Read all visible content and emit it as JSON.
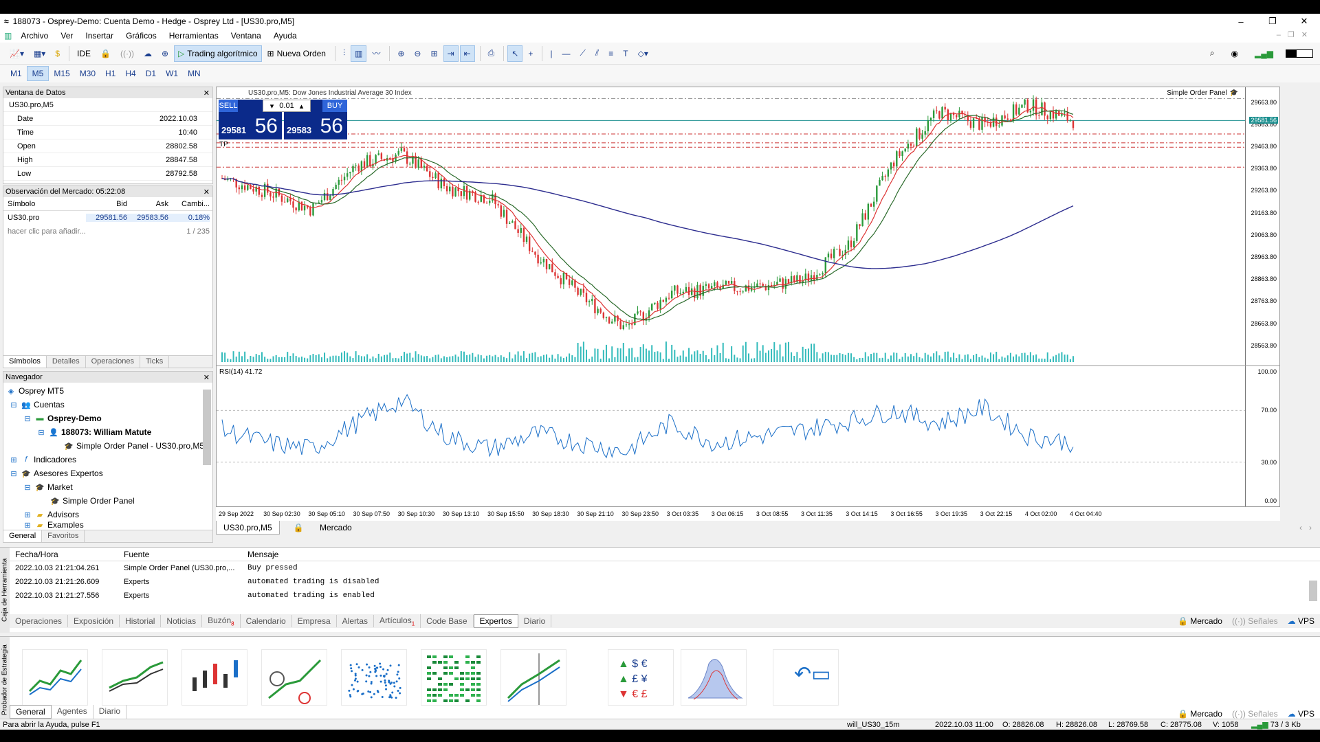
{
  "window": {
    "title": "188073 - Osprey-Demo: Cuenta Demo - Hedge - Osprey Ltd - [US30.pro,M5]",
    "controls": [
      "–",
      "❐",
      "✕"
    ]
  },
  "menu": [
    "Archivo",
    "Ver",
    "Insertar",
    "Gráficos",
    "Herramientas",
    "Ventana",
    "Ayuda"
  ],
  "toolbar": {
    "ide": "IDE",
    "algo": "Trading algorítmico",
    "new_order": "Nueva Orden"
  },
  "timeframes": [
    "M1",
    "M5",
    "M15",
    "M30",
    "H1",
    "H4",
    "D1",
    "W1",
    "MN"
  ],
  "active_tf": "M5",
  "data_window": {
    "title": "Ventana de Datos",
    "symbol": "US30.pro,M5",
    "rows": [
      {
        "k": "Date",
        "v": "2022.10.03"
      },
      {
        "k": "Time",
        "v": "10:40"
      },
      {
        "k": "Open",
        "v": "28802.58"
      },
      {
        "k": "High",
        "v": "28847.58"
      },
      {
        "k": "Low",
        "v": "28792.58"
      }
    ]
  },
  "market_watch": {
    "title": "Observación del Mercado: 05:22:08",
    "headers": [
      "Símbolo",
      "Bid",
      "Ask",
      "Cambi..."
    ],
    "row": {
      "symbol": "US30.pro",
      "bid": "29581.56",
      "ask": "29583.56",
      "change": "0.18%"
    },
    "add": "hacer clic para añadir...",
    "count": "1 / 235",
    "tabs": [
      "Símbolos",
      "Detalles",
      "Operaciones",
      "Ticks"
    ]
  },
  "navigator": {
    "title": "Navegador",
    "items": [
      "Osprey MT5",
      "Cuentas",
      "Osprey-Demo",
      "188073: William Matute",
      "Simple Order Panel - US30.pro,M5",
      "Indicadores",
      "Asesores Expertos",
      "Market",
      "Simple Order Panel",
      "Advisors",
      "Examples"
    ],
    "tabs": [
      "General",
      "Favoritos"
    ]
  },
  "chart": {
    "title": "US30.pro,M5:  Dow Jones Industrial Average 30 Index",
    "ea": "Simple Order Panel",
    "tp": "TP",
    "sell": "SELL",
    "buy": "BUY",
    "lot": "0.01",
    "sell_small": "29581",
    "sell_big": "56",
    "buy_small": "29583",
    "buy_big": "56",
    "price_tag": "29581.56",
    "rsi_label": "RSI(14) 41.72",
    "tabs": [
      "US30.pro,M5",
      "Mercado"
    ]
  },
  "chart_data": {
    "type": "line",
    "title": "Dow Jones Industrial Average 30 Index",
    "x": [
      "29 Sep 2022",
      "30 Sep 02:30",
      "30 Sep 05:10",
      "30 Sep 07:50",
      "30 Sep 10:30",
      "30 Sep 13:10",
      "30 Sep 15:50",
      "30 Sep 18:30",
      "30 Sep 21:10",
      "30 Sep 23:50",
      "3 Oct 03:35",
      "3 Oct 06:15",
      "3 Oct 08:55",
      "3 Oct 11:35",
      "3 Oct 14:15",
      "3 Oct 16:55",
      "3 Oct 19:35",
      "3 Oct 22:15",
      "4 Oct 02:00",
      "4 Oct 04:40"
    ],
    "series": [
      {
        "values": [
          29320,
          29260,
          29180,
          29380,
          29430,
          29280,
          29230,
          28980,
          28790,
          28640,
          28800,
          28820,
          28830,
          28860,
          29020,
          29400,
          29620,
          29560,
          29650,
          29581
        ]
      }
    ],
    "yticks": [
      "29663.80",
      "29563.80",
      "29463.80",
      "29363.80",
      "29263.80",
      "29163.80",
      "29063.80",
      "28963.80",
      "28863.80",
      "28763.80",
      "28663.80",
      "28563.80"
    ],
    "ylim": [
      28520,
      29700
    ],
    "rsi": {
      "values": [
        55,
        45,
        40,
        60,
        78,
        50,
        40,
        52,
        45,
        38,
        60,
        45,
        50,
        55,
        62,
        70,
        60,
        72,
        50,
        45
      ],
      "yticks": [
        "100.00",
        "70.00",
        "30.00",
        "0.00"
      ]
    }
  },
  "toolbox": {
    "label": "Caja de Herramienta",
    "headers": [
      "Fecha/Hora",
      "Fuente",
      "Mensaje"
    ],
    "rows": [
      {
        "t": "2022.10.03 21:21:04.261",
        "s": "Simple Order Panel (US30.pro,...",
        "m": "Buy pressed"
      },
      {
        "t": "2022.10.03 21:21:26.609",
        "s": "Experts",
        "m": "automated trading is disabled"
      },
      {
        "t": "2022.10.03 21:21:27.556",
        "s": "Experts",
        "m": "automated trading is enabled"
      }
    ],
    "tabs": [
      "Operaciones",
      "Exposición",
      "Historial",
      "Noticias",
      "Buzón",
      "Calendario",
      "Empresa",
      "Alertas",
      "Artículos",
      "Code Base",
      "Expertos",
      "Diario"
    ],
    "active": "Expertos",
    "badges": {
      "buzon": "8",
      "articulos": "1"
    },
    "right": [
      "Mercado",
      "Señales",
      "VPS"
    ]
  },
  "tester": {
    "label": "Probador de Estrategia",
    "tabs": [
      "General",
      "Agentes",
      "Diario"
    ],
    "right": [
      "Mercado",
      "Señales",
      "VPS"
    ]
  },
  "status": {
    "help": "Para abrir la Ayuda, pulse F1",
    "profile": "will_US30_15m",
    "time": "2022.10.03 11:00",
    "o": "O: 28826.08",
    "h": "H: 28826.08",
    "l": "L: 28769.58",
    "c": "C: 28775.08",
    "v": "V: 1058",
    "net": "73 / 3 Kb"
  }
}
